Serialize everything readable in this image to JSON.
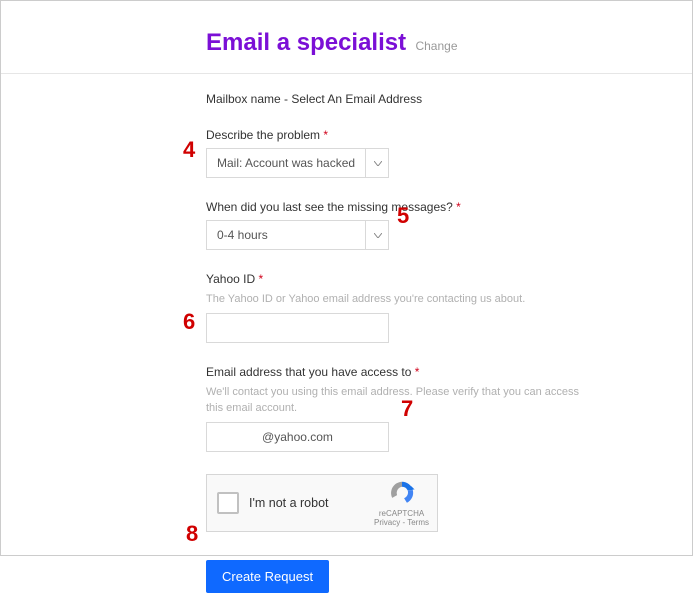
{
  "header": {
    "title": "Email a specialist",
    "change": "Change"
  },
  "mailbox_line": "Mailbox name - Select An Email Address",
  "fields": {
    "problem": {
      "label": "Describe the problem",
      "value": "Mail: Account was hacked"
    },
    "lastseen": {
      "label": "When did you last see the missing messages?",
      "value": "0-4 hours"
    },
    "yahoo_id": {
      "label": "Yahoo ID",
      "help": "The Yahoo ID or Yahoo email address you're contacting us about.",
      "value": ""
    },
    "contact_email": {
      "label": "Email address that you have access to",
      "help": "We'll contact you using this email address. Please verify that you can access this email account.",
      "value": "@yahoo.com"
    }
  },
  "recaptcha": {
    "label": "I'm not a robot",
    "brand": "reCAPTCHA",
    "links": "Privacy - Terms"
  },
  "submit": {
    "label": "Create Request"
  },
  "markers": {
    "m4": "4",
    "m5": "5",
    "m6": "6",
    "m7": "7",
    "m8": "8"
  }
}
